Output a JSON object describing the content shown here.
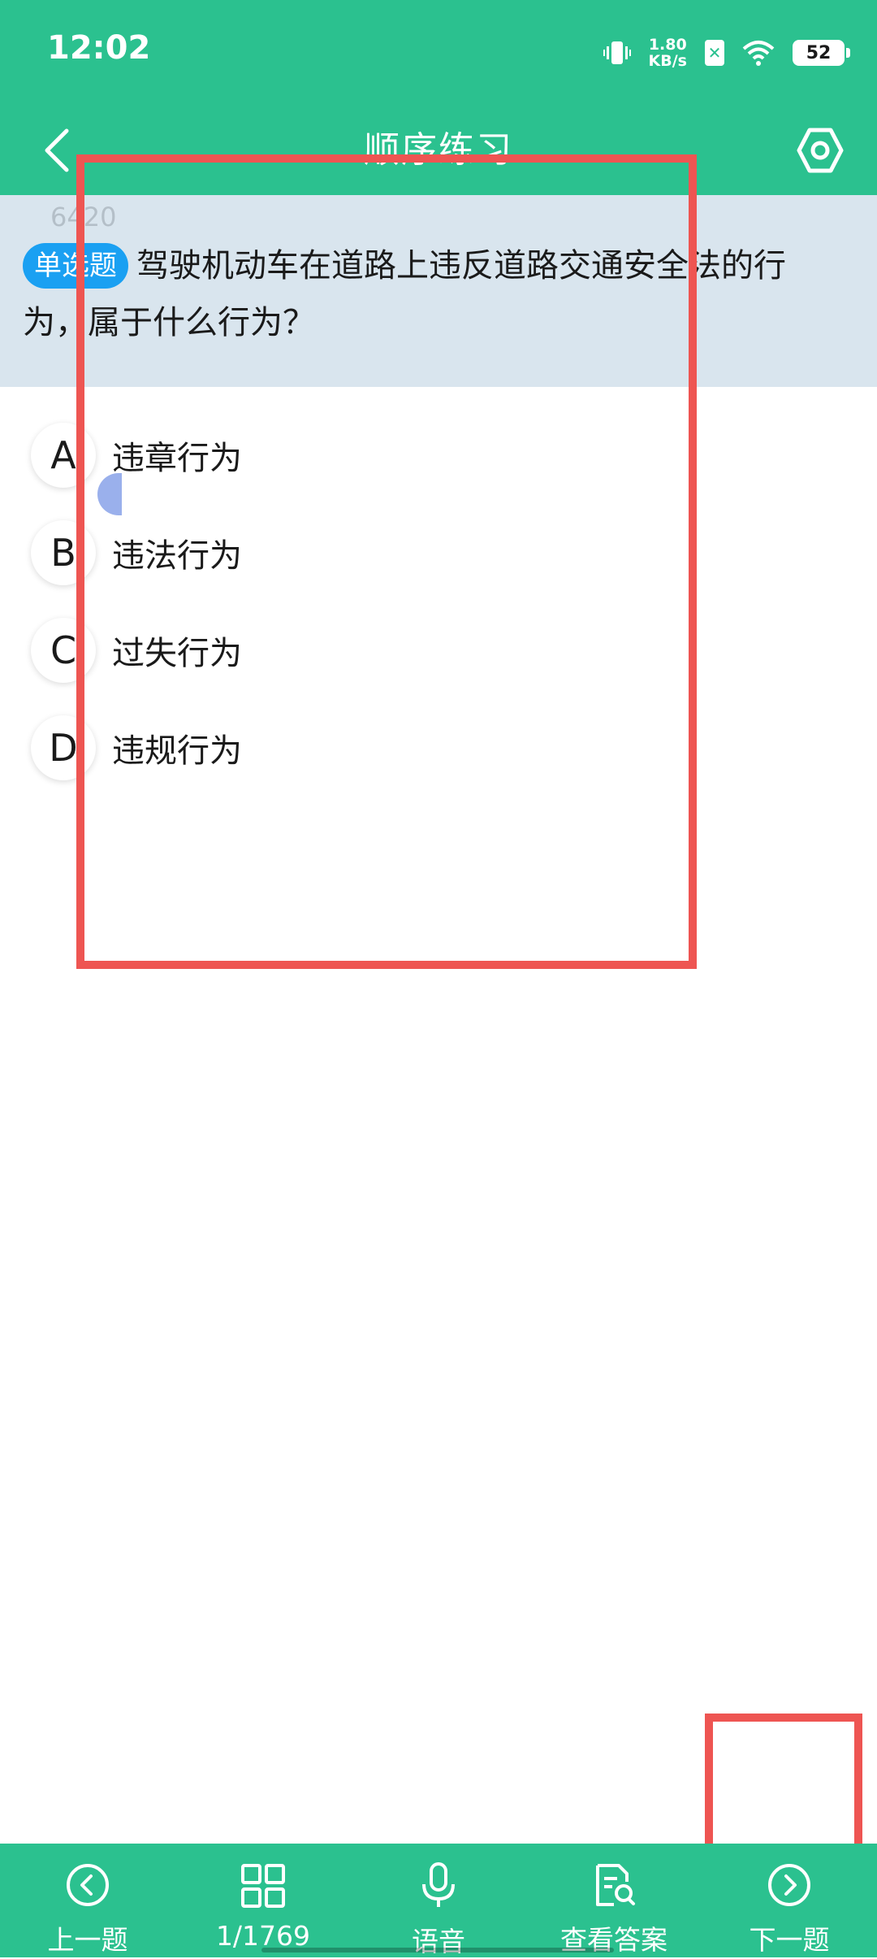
{
  "status_bar": {
    "time": "12:02",
    "net_speed_value": "1.80",
    "net_speed_unit": "KB/s",
    "battery": "52",
    "icons": [
      "vibrate-icon",
      "sim-x-icon",
      "wifi-icon",
      "battery-icon"
    ]
  },
  "app_bar": {
    "title": "顺序练习",
    "back_icon": "chevron-left-icon",
    "settings_icon": "hexagon-gear-icon"
  },
  "question": {
    "number": "6420",
    "type_badge": "单选题",
    "text": "驾驶机动车在道路上违反道路交通安全法的行为，属于什么行为？",
    "options": [
      {
        "letter": "A",
        "text": "违章行为"
      },
      {
        "letter": "B",
        "text": "违法行为"
      },
      {
        "letter": "C",
        "text": "过失行为"
      },
      {
        "letter": "D",
        "text": "违规行为"
      }
    ]
  },
  "bottom_nav": {
    "prev": {
      "label": "上一题",
      "icon": "circle-chevron-left-icon"
    },
    "progress": {
      "label": "1/1769",
      "icon": "grid-icon"
    },
    "voice": {
      "label": "语音",
      "icon": "microphone-icon"
    },
    "answer": {
      "label": "查看答案",
      "icon": "document-search-icon"
    },
    "next": {
      "label": "下一题",
      "icon": "circle-chevron-right-icon"
    }
  },
  "colors": {
    "primary": "#2bc18f",
    "question_bg": "#d9e5ee",
    "badge": "#1aa0f2",
    "annotation": "#ee5552"
  }
}
